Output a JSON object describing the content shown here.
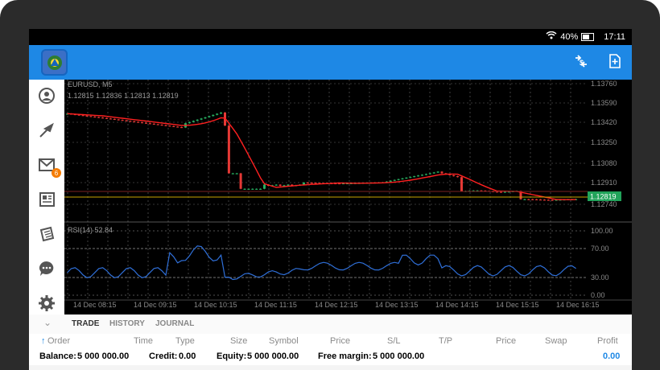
{
  "status": {
    "signal": "40%",
    "time": "17:11"
  },
  "appbar": {
    "actions": [
      "trade-toggle",
      "new-order"
    ]
  },
  "sidebar": {
    "items": [
      {
        "name": "quotes",
        "icon": "quotes-icon"
      },
      {
        "name": "trade",
        "icon": "trade-icon"
      },
      {
        "name": "mail",
        "icon": "mail-icon",
        "badge": "6"
      },
      {
        "name": "news",
        "icon": "news-icon"
      },
      {
        "name": "journal",
        "icon": "journal-icon"
      },
      {
        "name": "chat",
        "icon": "chat-icon"
      },
      {
        "name": "settings",
        "icon": "settings-icon"
      }
    ]
  },
  "chart": {
    "symbol": "EURUSD, M5",
    "ohlc": "1.12815 1.12836 1.12813 1.12819",
    "indicator": "RSI(14) 52.84",
    "current_price": "1.12819",
    "price_ticks": [
      "1.13760",
      "1.13590",
      "1.13420",
      "1.13250",
      "1.13080",
      "1.12910",
      "1.12740"
    ],
    "rsi_ticks": [
      "100.00",
      "70.00",
      "30.00",
      "0.00"
    ],
    "time_ticks": [
      "14 Dec 08:15",
      "14 Dec 09:15",
      "14 Dec 10:15",
      "14 Dec 11:15",
      "14 Dec 12:15",
      "14 Dec 13:15",
      "14 Dec 14:15",
      "14 Dec 15:15",
      "14 Dec 16:15"
    ],
    "colors": {
      "bull": "#27ae60",
      "bear": "#e53935",
      "ma": "#ff1e1e",
      "rsi": "#2b6fd6",
      "grid": "#6a6a6a"
    }
  },
  "tabs": {
    "items": [
      "TRADE",
      "HISTORY",
      "JOURNAL"
    ],
    "active": "TRADE"
  },
  "table": {
    "columns": [
      "Order",
      "Time",
      "Type",
      "Size",
      "Symbol",
      "Price",
      "S/L",
      "T/P",
      "Price",
      "Swap",
      "Profit"
    ]
  },
  "account": {
    "balance_label": "Balance:",
    "balance": "5 000 000.00",
    "credit_label": "Credit:",
    "credit": "0.00",
    "equity_label": "Equity:",
    "equity": "5 000 000.00",
    "free_margin_label": "Free margin:",
    "free_margin": "5 000 000.00",
    "profit": "0.00"
  }
}
